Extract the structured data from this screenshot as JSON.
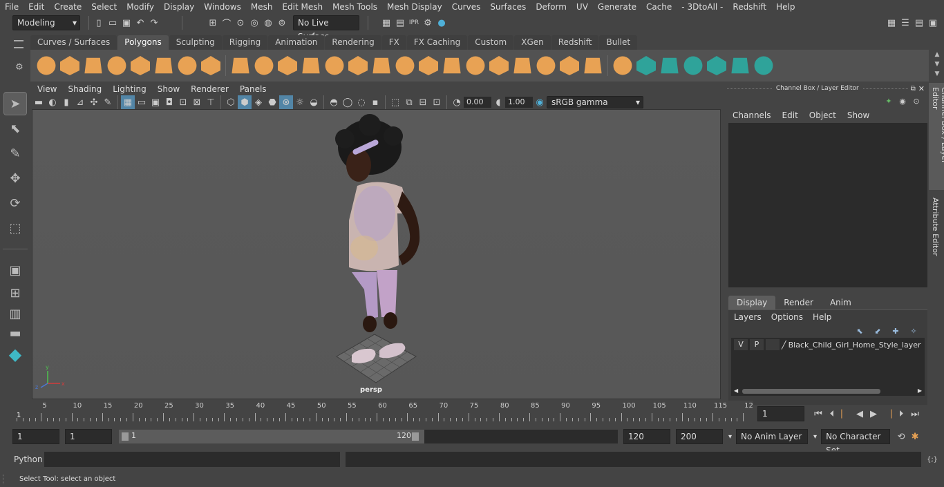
{
  "menubar": [
    "File",
    "Edit",
    "Create",
    "Select",
    "Modify",
    "Display",
    "Windows",
    "Mesh",
    "Edit Mesh",
    "Mesh Tools",
    "Mesh Display",
    "Curves",
    "Surfaces",
    "Deform",
    "UV",
    "Generate",
    "Cache",
    "- 3DtoAll -",
    "Redshift",
    "Help"
  ],
  "status": {
    "mode": "Modeling",
    "live_surface": "No Live Surface"
  },
  "shelf_tabs": [
    "Curves / Surfaces",
    "Polygons",
    "Sculpting",
    "Rigging",
    "Animation",
    "Rendering",
    "FX",
    "FX Caching",
    "Custom",
    "XGen",
    "Redshift",
    "Bullet"
  ],
  "shelf_active": "Polygons",
  "viewport": {
    "menu": [
      "View",
      "Shading",
      "Lighting",
      "Show",
      "Renderer",
      "Panels"
    ],
    "exposure": "0.00",
    "gamma": "1.00",
    "color_space": "sRGB gamma",
    "camera_label": "persp"
  },
  "channel_box": {
    "title": "Channel Box / Layer Editor",
    "menu": [
      "Channels",
      "Edit",
      "Object",
      "Show"
    ],
    "layer_tabs": [
      "Display",
      "Render",
      "Anim"
    ],
    "layer_menu": [
      "Layers",
      "Options",
      "Help"
    ],
    "layer": {
      "v": "V",
      "p": "P",
      "name": "Black_Child_Girl_Home_Style_layer"
    }
  },
  "side_tabs": {
    "channel_box": "Channel Box / Layer Editor",
    "attribute_editor": "Attribute Editor"
  },
  "timeline": {
    "ticks": [
      "5",
      "10",
      "15",
      "20",
      "25",
      "30",
      "35",
      "40",
      "45",
      "50",
      "55",
      "60",
      "65",
      "70",
      "75",
      "80",
      "85",
      "90",
      "95",
      "100",
      "105",
      "110",
      "115",
      "12"
    ],
    "first_frame": "1",
    "current_frame": "1"
  },
  "range": {
    "start": "1",
    "playback_start": "1",
    "slider_start": "1",
    "slider_end": "120",
    "playback_end": "120",
    "end": "200",
    "anim_layer": "No Anim Layer",
    "char_set": "No Character Set"
  },
  "cmd": {
    "label": "Python"
  },
  "help_line": "Select Tool: select an object",
  "colors": {
    "accent": "#5285a6",
    "shelf_orange": "#e8a254",
    "shelf_teal": "#2fa39a"
  }
}
